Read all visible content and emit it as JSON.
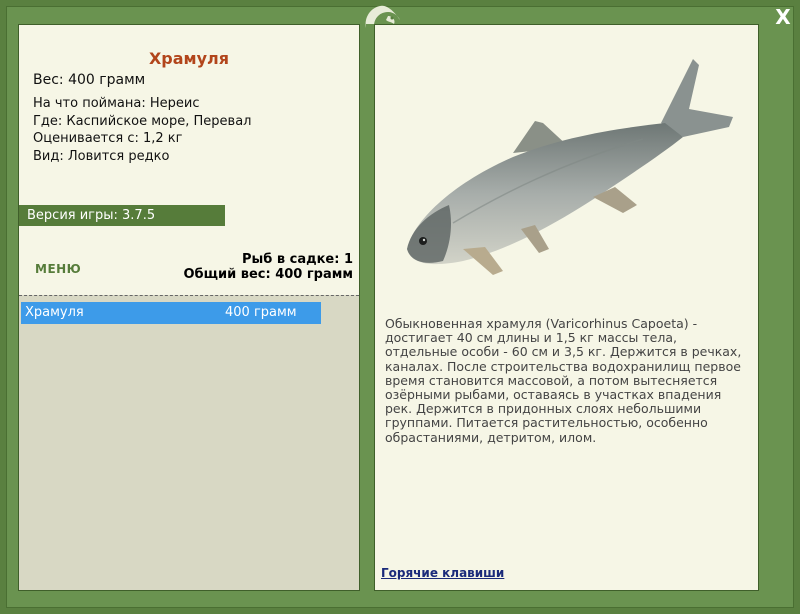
{
  "window": {
    "close_label": "X"
  },
  "fish": {
    "name": "Храмуля",
    "weight_line": "Вес: 400 грамм",
    "caught_on": "На что поймана: Нереис",
    "location": "Где: Каспийское море, Перевал",
    "value": "Оценивается с: 1,2 кг",
    "rarity": "Вид: Ловится редко"
  },
  "version": "Версия игры: 3.7.5",
  "menu_label": "МЕНЮ",
  "keepnet": {
    "count": "Рыб в садке: 1",
    "total_weight": "Общий вес: 400 грамм"
  },
  "catch_list": [
    {
      "name": "Храмуля",
      "weight": "400 грамм"
    }
  ],
  "description": "Обыкновенная храмуля (Varicorhinus Capoeta) - достигает 40 см длины и 1,5 кг массы тела, отдельные особи - 60 см и 3,5 кг. Держится в речках, каналах. После строительства водохранилищ первое время становится массовой, а потом вытесняется озёрными рыбами, оставаясь в участках впадения рек. Держится в придонных слоях небольшими группами. Питается растительностью, особенно обрастаниями, детритом, илом.",
  "hotkeys_label": "Горячие клавиши",
  "colors": {
    "frame_green": "#5a8040",
    "title_orange": "#b2451b",
    "selection_blue": "#3d9be9",
    "panel_cream": "#f6f6e6"
  }
}
